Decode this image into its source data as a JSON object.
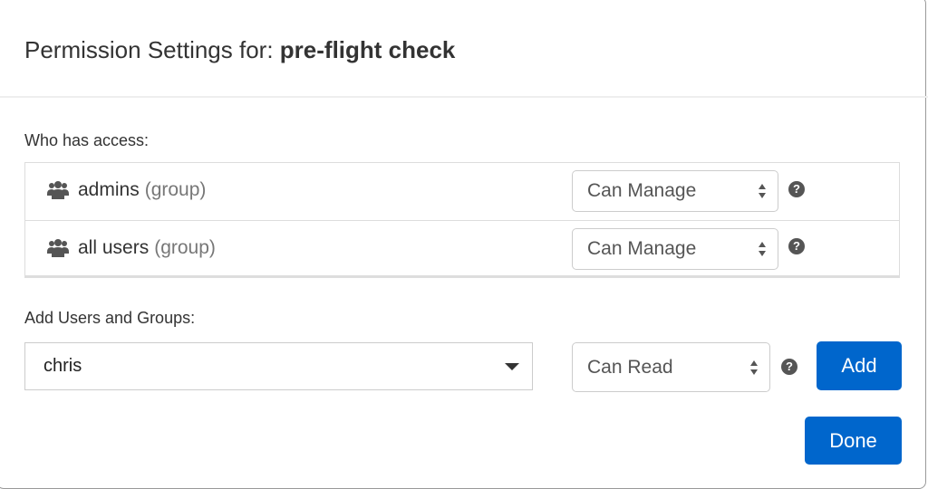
{
  "header": {
    "title_prefix": "Permission Settings for:",
    "title_object": "pre-flight check"
  },
  "access": {
    "label": "Who has access:",
    "rows": [
      {
        "icon": "group-icon",
        "name": "admins",
        "type": "(group)",
        "permission": "Can Manage",
        "help": "?"
      },
      {
        "icon": "group-icon",
        "name": "all users",
        "type": "(group)",
        "permission": "Can Manage",
        "help": "?"
      }
    ]
  },
  "add": {
    "label": "Add Users and Groups:",
    "user_value": "chris",
    "permission": "Can Read",
    "help": "?",
    "add_label": "Add"
  },
  "footer": {
    "done_label": "Done"
  },
  "colors": {
    "primary": "#0066cc",
    "text": "#333333",
    "muted": "#777777",
    "border": "#dddddd"
  }
}
